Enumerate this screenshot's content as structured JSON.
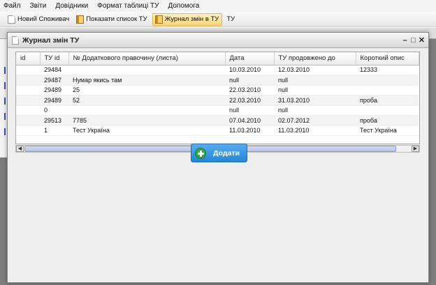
{
  "menu": [
    "Файл",
    "Звіти",
    "Довідники",
    "Формат таблиці ТУ",
    "Допомога"
  ],
  "toolbar_tabs": [
    {
      "label": "Новий Споживач",
      "icon": "document-icon",
      "active": false
    },
    {
      "label": "Показати список ТУ",
      "icon": "book-icon",
      "active": false
    },
    {
      "label": "Журнал змін в ТУ",
      "icon": "book-icon",
      "active": true
    },
    {
      "label": "ТУ",
      "icon": "",
      "active": false
    }
  ],
  "dialog": {
    "title": "Журнал змін ТУ",
    "window_buttons": [
      "minimize-icon",
      "maximize-icon",
      "close-icon"
    ]
  },
  "table": {
    "columns": [
      "id",
      "ТУ id",
      "№ Додаткового правочину (листа)",
      "Дата",
      "ТУ продовжено до",
      "Короткий опис"
    ],
    "rows": [
      [
        "",
        "29484",
        "",
        "10.03.2010",
        "12.03.2010",
        "12333"
      ],
      [
        "",
        "29487",
        "Нумар якись там",
        "null",
        "null",
        ""
      ],
      [
        "",
        "29489",
        "25",
        "22.03.2010",
        "null",
        ""
      ],
      [
        "",
        "29489",
        "52",
        "22.03.2010",
        "31.03.2010",
        "проба"
      ],
      [
        "",
        "0",
        "",
        "null",
        "null",
        ""
      ],
      [
        "",
        "29513",
        "7785",
        "07.04.2010",
        "02.07.2012",
        "проба"
      ],
      [
        "",
        "1",
        "Тест Україна",
        "11.03.2010",
        "11.03.2010",
        "Тест Україна"
      ]
    ]
  },
  "add_button": {
    "label": "Додати",
    "icon": "plus-circle-icon"
  },
  "colors": {
    "accent": "#2286d8",
    "add_icon": "#2fa84a",
    "active_tab": "#f6d67c"
  }
}
